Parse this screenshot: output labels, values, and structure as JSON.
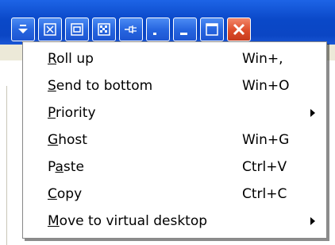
{
  "colors": {
    "titlebar": "#0b46c4",
    "button": "#2766e0",
    "close_button": "#dd4c2a",
    "menu_background": "#ffffff",
    "menu_text": "#000000"
  },
  "titlebar_buttons": [
    {
      "icon": "menu-down-arrow-icon"
    },
    {
      "icon": "maximize-expand-icon"
    },
    {
      "icon": "frame-icon"
    },
    {
      "icon": "transparency-checker-icon"
    },
    {
      "icon": "pin-icon"
    },
    {
      "icon": "roll-up-icon"
    },
    {
      "icon": "minimize-icon"
    },
    {
      "icon": "maximize-icon"
    },
    {
      "icon": "close-icon"
    }
  ],
  "menu": {
    "items": [
      {
        "pre": "",
        "accel": "R",
        "post": "oll up",
        "shortcut": "Win+,",
        "submenu": false
      },
      {
        "pre": "",
        "accel": "S",
        "post": "end to bottom",
        "shortcut": "Win+O",
        "submenu": false
      },
      {
        "pre": "",
        "accel": "P",
        "post": "riority",
        "shortcut": "",
        "submenu": true
      },
      {
        "pre": "",
        "accel": "G",
        "post": "host",
        "shortcut": "Win+G",
        "submenu": false
      },
      {
        "pre": "P",
        "accel": "a",
        "post": "ste",
        "shortcut": "Ctrl+V",
        "submenu": false
      },
      {
        "pre": "",
        "accel": "C",
        "post": "opy",
        "shortcut": "Ctrl+C",
        "submenu": false
      },
      {
        "pre": "",
        "accel": "M",
        "post": "ove to virtual desktop",
        "shortcut": "",
        "submenu": true
      }
    ]
  }
}
